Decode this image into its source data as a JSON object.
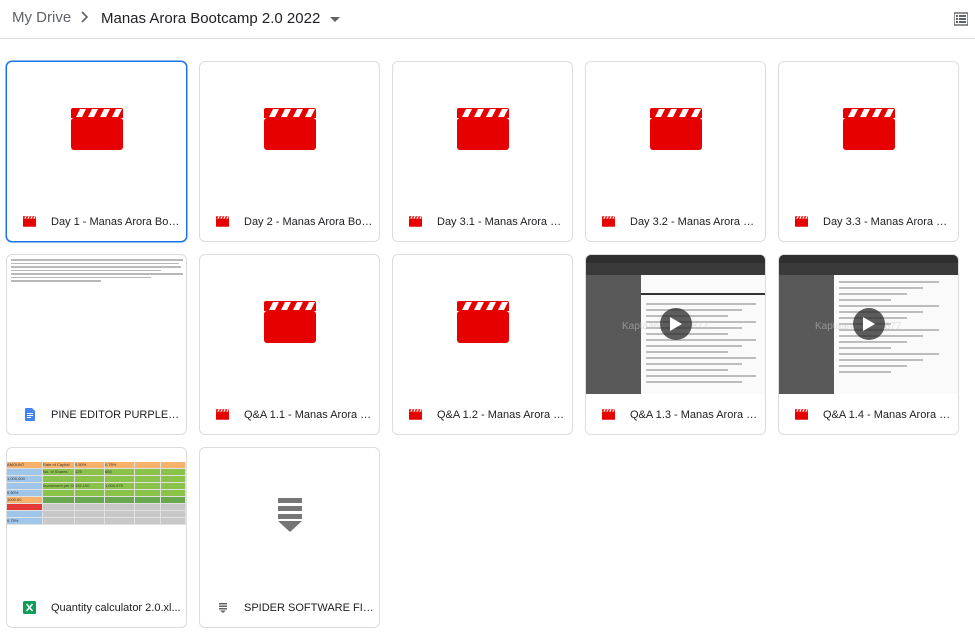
{
  "breadcrumb": {
    "root": "My Drive",
    "current": "Manas Arora Bootcamp 2.0 2022"
  },
  "colors": {
    "video_red": "#e60000",
    "selected_border": "#1a73e8",
    "doc_blue": "#4285f4",
    "sheet_green": "#0f9d58"
  },
  "files": [
    {
      "name": "Day 1 - Manas Arora Boo...",
      "type": "video",
      "icon": "video-clapper-icon",
      "selected": true
    },
    {
      "name": "Day 2 - Manas Arora Boo...",
      "type": "video",
      "icon": "video-clapper-icon"
    },
    {
      "name": "Day 3.1 - Manas Arora Bo...",
      "type": "video",
      "icon": "video-clapper-icon"
    },
    {
      "name": "Day 3.2 - Manas Arora Bo...",
      "type": "video",
      "icon": "video-clapper-icon"
    },
    {
      "name": "Day 3.3 - Manas Arora Bo...",
      "type": "video",
      "icon": "video-clapper-icon"
    },
    {
      "name": "PINE EDITOR PURPLE DO...",
      "type": "document",
      "icon": "docs-icon"
    },
    {
      "name": "Q&A 1.1 - Manas Arora B...",
      "type": "video",
      "icon": "video-clapper-icon"
    },
    {
      "name": "Q&A 1.2 - Manas Arora B...",
      "type": "video",
      "icon": "video-clapper-icon"
    },
    {
      "name": "Q&A 1.3 - Manas Arora B...",
      "type": "video",
      "icon": "video-clapper-icon",
      "watermark": "Kaptaan…h779877"
    },
    {
      "name": "Q&A 1.4 - Manas Arora B...",
      "type": "video",
      "icon": "video-clapper-icon",
      "watermark": "Kaptaan…h779877"
    },
    {
      "name": "Quantity calculator 2.0.xl...",
      "type": "spreadsheet",
      "icon": "sheets-icon"
    },
    {
      "name": "SPIDER SOFTWARE FILE...",
      "type": "archive",
      "icon": "archive-icon"
    }
  ],
  "sheet_preview": {
    "cells": [
      "AMOUNT",
      "Rate of Capital",
      "0.50%",
      "0.75%",
      "No. of Shares",
      "125",
      "666",
      "1,000,000",
      "Investment per Order in Rupees",
      "132,100",
      "1,000,975",
      "0.50%",
      "1000.00",
      "0.75%"
    ]
  }
}
